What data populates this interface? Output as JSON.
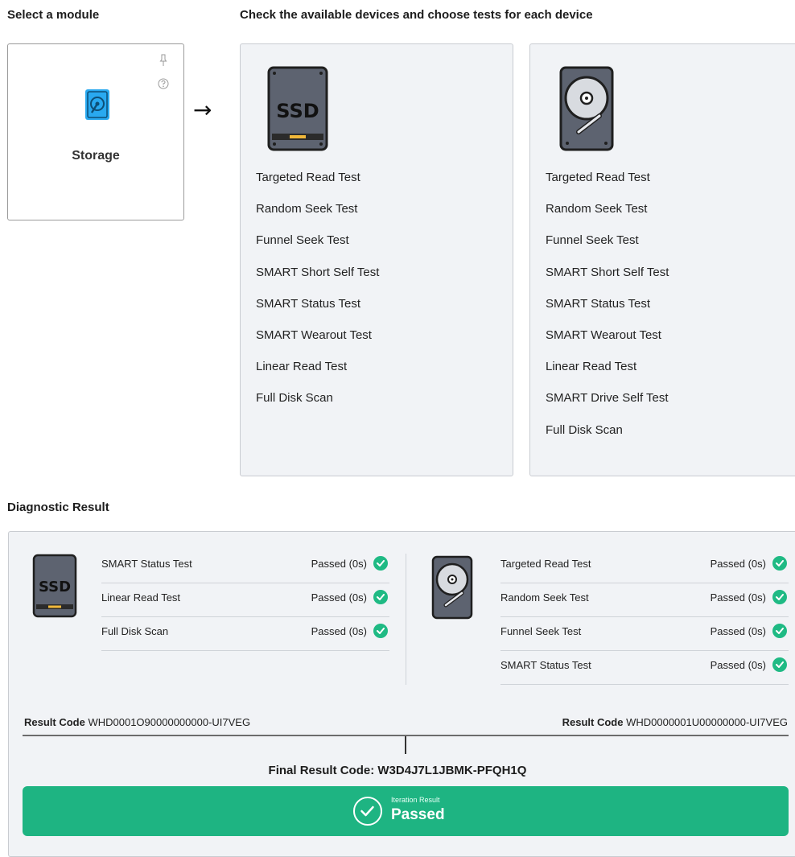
{
  "header": {
    "module_title": "Select a module",
    "devices_title": "Check the available devices and choose tests for each device"
  },
  "module": {
    "label": "Storage",
    "icon": "storage-icon",
    "pin_icon": "pin-icon",
    "help_icon": "help-icon",
    "arrow": "→"
  },
  "devices": [
    {
      "icon": "ssd-icon",
      "icon_text": "SSD",
      "tests": [
        "Targeted Read Test",
        "Random Seek Test",
        "Funnel Seek Test",
        "SMART Short Self Test",
        "SMART Status Test",
        "SMART Wearout Test",
        "Linear Read Test",
        "Full Disk Scan"
      ]
    },
    {
      "icon": "hdd-icon",
      "tests": [
        "Targeted Read Test",
        "Random Seek Test",
        "Funnel Seek Test",
        "SMART Short Self Test",
        "SMART Status Test",
        "SMART Wearout Test",
        "Linear Read Test",
        "SMART Drive Self Test",
        "Full Disk Scan"
      ]
    }
  ],
  "result": {
    "title": "Diagnostic Result",
    "ssd": {
      "icon_text": "SSD",
      "rows": [
        {
          "name": "SMART Status Test",
          "status": "Passed (0s)"
        },
        {
          "name": "Linear Read Test",
          "status": "Passed (0s)"
        },
        {
          "name": "Full Disk Scan",
          "status": "Passed (0s)"
        }
      ],
      "code_label": "Result Code",
      "code": "WHD0001O90000000000-UI7VEG"
    },
    "hdd": {
      "rows": [
        {
          "name": "Targeted Read Test",
          "status": "Passed (0s)"
        },
        {
          "name": "Random Seek Test",
          "status": "Passed (0s)"
        },
        {
          "name": "Funnel Seek Test",
          "status": "Passed (0s)"
        },
        {
          "name": "SMART Status Test",
          "status": "Passed (0s)"
        }
      ],
      "code_label": "Result Code",
      "code": "WHD0000001U00000000-UI7VEG"
    },
    "final_code": "Final Result Code: W3D4J7L1JBMK-PFQH1Q",
    "iteration_label": "Iteration Result",
    "iteration_value": "Passed",
    "colors": {
      "passed": "#1eb482",
      "accent_blue": "#29a9f0"
    }
  }
}
